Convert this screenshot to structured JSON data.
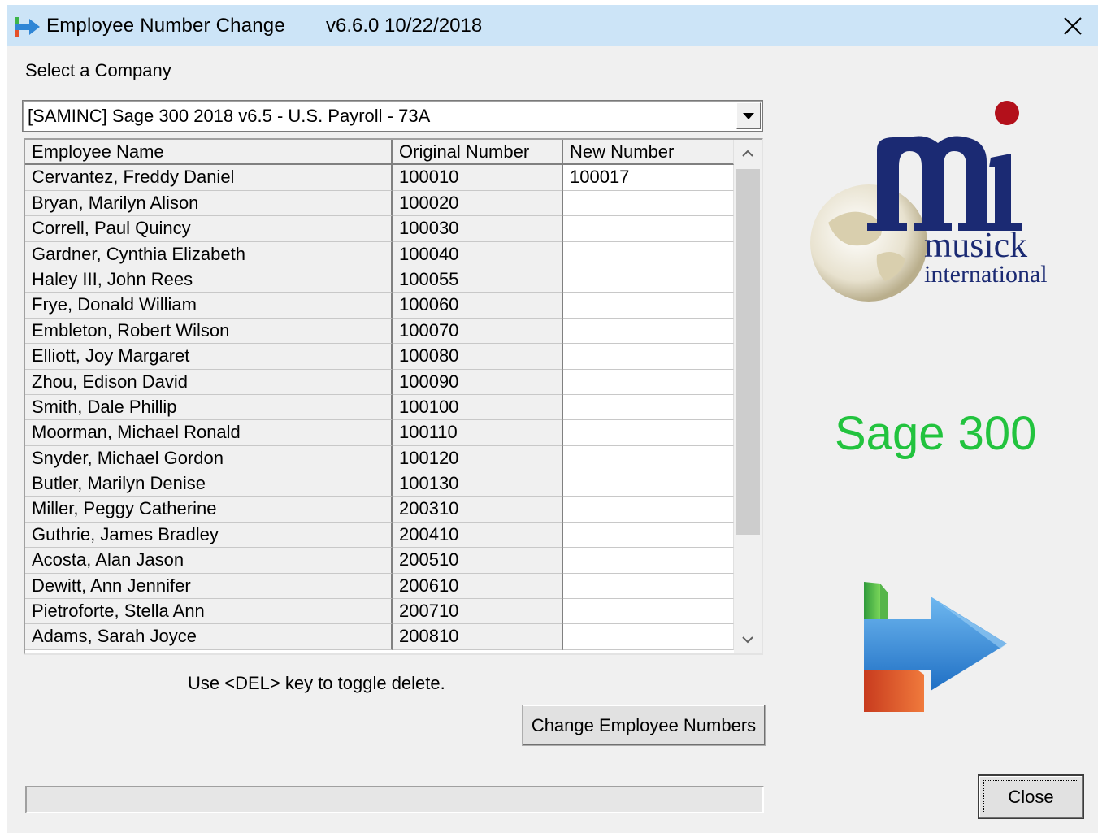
{
  "window": {
    "title": "Employee Number Change",
    "version": "v6.6.0  10/22/2018",
    "close_icon": "close-icon"
  },
  "company": {
    "label": "Select a Company",
    "selected": "[SAMINC] Sage 300  2018  v6.5 - U.S. Payroll - 73A"
  },
  "grid": {
    "columns": [
      "Employee Name",
      "Original Number",
      "New Number"
    ],
    "rows": [
      {
        "name": "Cervantez, Freddy Daniel",
        "original": "100010",
        "new": "100017"
      },
      {
        "name": "Bryan, Marilyn Alison",
        "original": "100020",
        "new": ""
      },
      {
        "name": "Correll, Paul Quincy",
        "original": "100030",
        "new": ""
      },
      {
        "name": "Gardner, Cynthia Elizabeth",
        "original": "100040",
        "new": ""
      },
      {
        "name": "Haley III, John Rees",
        "original": "100055",
        "new": ""
      },
      {
        "name": "Frye, Donald William",
        "original": "100060",
        "new": ""
      },
      {
        "name": "Embleton, Robert Wilson",
        "original": "100070",
        "new": ""
      },
      {
        "name": "Elliott, Joy Margaret",
        "original": "100080",
        "new": ""
      },
      {
        "name": "Zhou, Edison David",
        "original": "100090",
        "new": ""
      },
      {
        "name": "Smith, Dale Phillip",
        "original": "100100",
        "new": ""
      },
      {
        "name": "Moorman, Michael Ronald",
        "original": "100110",
        "new": ""
      },
      {
        "name": "Snyder, Michael Gordon",
        "original": "100120",
        "new": ""
      },
      {
        "name": "Butler, Marilyn Denise",
        "original": "100130",
        "new": ""
      },
      {
        "name": "Miller, Peggy Catherine",
        "original": "200310",
        "new": ""
      },
      {
        "name": "Guthrie, James Bradley",
        "original": "200410",
        "new": ""
      },
      {
        "name": "Acosta, Alan Jason",
        "original": "200510",
        "new": ""
      },
      {
        "name": "Dewitt, Ann Jennifer",
        "original": "200610",
        "new": ""
      },
      {
        "name": "Pietroforte, Stella Ann",
        "original": "200710",
        "new": ""
      },
      {
        "name": "Adams, Sarah Joyce",
        "original": "200810",
        "new": ""
      }
    ]
  },
  "hint": "Use <DEL> key to toggle delete.",
  "buttons": {
    "change": "Change Employee Numbers",
    "close": "Close"
  },
  "branding": {
    "logo_line1": "musick",
    "logo_line2": "international",
    "product": "Sage 300",
    "product_color": "#22c33e",
    "logo_color": "#1b2a73",
    "dot_color": "#b3101b"
  }
}
